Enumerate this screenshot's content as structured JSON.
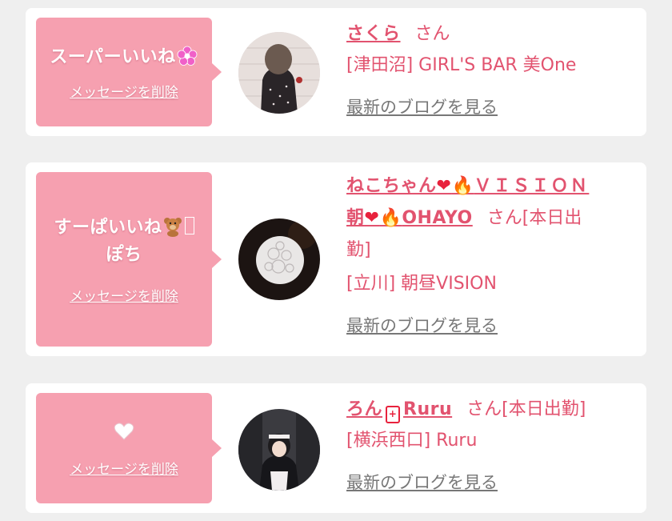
{
  "cards": [
    {
      "like_text": "スーパーいいね",
      "like_emoji": "flower-icon",
      "delete_label": "メッセージを削除",
      "name": "さくら",
      "san": "さん",
      "shop": "[津田沼] GIRL'S BAR 美One",
      "blog_label": "最新のブログを見る"
    },
    {
      "like_text_line1": "すーぱいいね",
      "like_text_line2": "ぽち",
      "like_emoji": "teddy-bear-icon",
      "delete_label": "メッセージを削除",
      "name_part1": "ねこちゃん",
      "name_part2": "ＶＩＳＩＯＮ",
      "name_part3": "朝",
      "name_part4": "OHAYO",
      "san": "さん[本日出",
      "san_line2": "勤]",
      "shop": "[立川] 朝昼VISION",
      "blog_label": "最新のブログを見る"
    },
    {
      "like_emoji": "white-heart-icon",
      "delete_label": "メッセージを削除",
      "name_part1": "ろん",
      "name_part2": "Ruru",
      "san": "さん[本日出勤]",
      "shop": "[横浜西口] Ruru",
      "blog_label": "最新のブログを見る"
    }
  ],
  "colors": {
    "bubble": "#f6a0b0",
    "accent": "#e2536f",
    "heart": "#e8223d",
    "link_gray": "#777777"
  }
}
